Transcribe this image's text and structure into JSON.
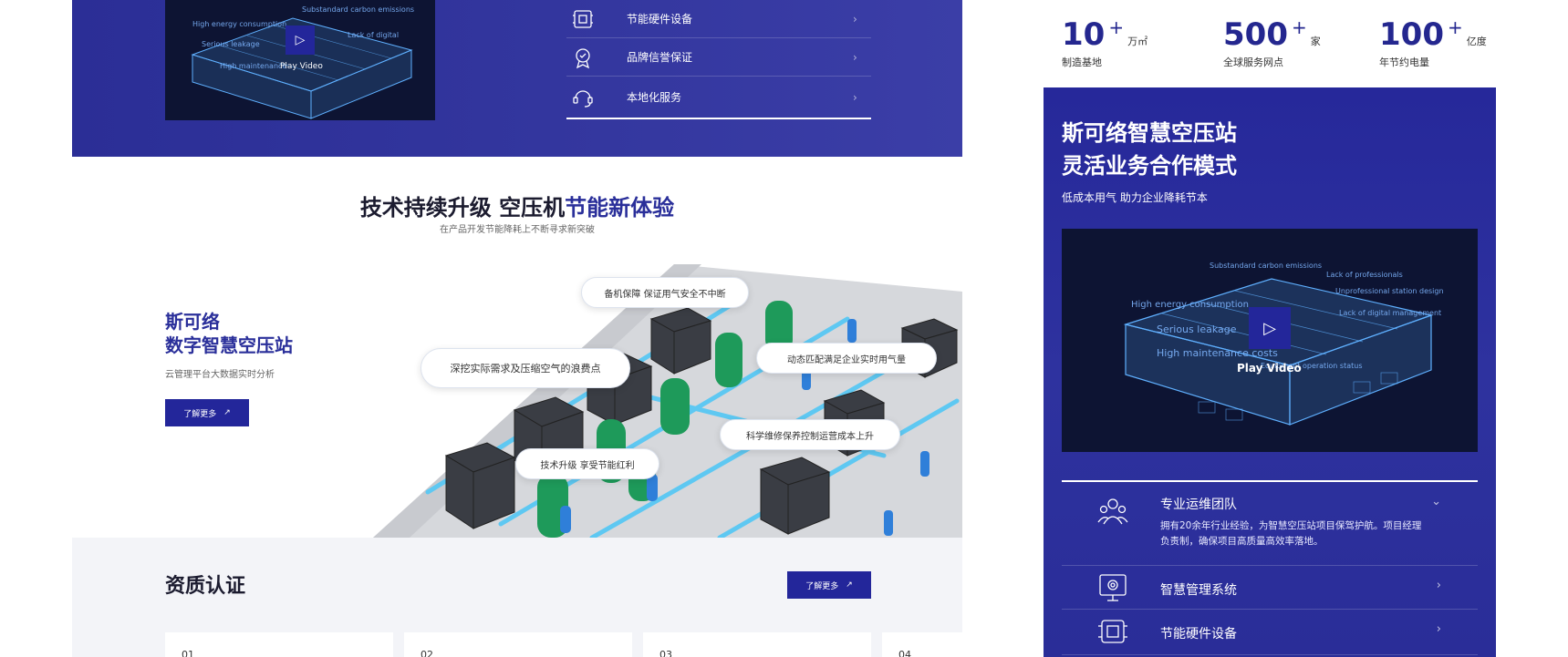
{
  "left_video": {
    "play_label": "Play Video",
    "overlay_labels": [
      "High energy consumption",
      "Substandard carbon emissions",
      "Serious leakage",
      "Lack of digital",
      "High maintenance"
    ]
  },
  "services": [
    {
      "label": "节能硬件设备",
      "icon": "hardware-icon"
    },
    {
      "label": "品牌信誉保证",
      "icon": "badge-icon"
    },
    {
      "label": "本地化服务",
      "icon": "support-icon"
    }
  ],
  "tech": {
    "title_dark": "技术持续升级 空压机",
    "title_accent": "节能新体验",
    "subtitle": "在产品开发节能降耗上不断寻求新突破"
  },
  "brand": {
    "line1": "斯可络",
    "line2": "数字智慧空压站",
    "subtitle": "云管理平台大数据实时分析",
    "button": "了解更多"
  },
  "bubbles": [
    "备机保障 保证用气安全不中断",
    "深挖实际需求及压缩空气的浪费点",
    "动态匹配满足企业实时用气量",
    "科学维修保养控制运营成本上升",
    "技术升级 享受节能红利"
  ],
  "qualification": {
    "title": "资质认证",
    "button": "了解更多",
    "cards": [
      "01",
      "02",
      "03",
      "04"
    ]
  },
  "stats": [
    {
      "number": "10",
      "plus": "+",
      "unit": "万㎡",
      "desc": "制造基地"
    },
    {
      "number": "500",
      "plus": "+",
      "unit": "家",
      "desc": "全球服务网点"
    },
    {
      "number": "100",
      "plus": "+",
      "unit": "亿度",
      "desc": "年节约电量"
    }
  ],
  "right_panel": {
    "title_line1": "斯可络智慧空压站",
    "title_line2": "灵活业务合作模式",
    "subtitle": "低成本用气 助力企业降耗节本",
    "video": {
      "play_label": "Play Video",
      "overlay_labels": [
        "Substandard carbon emissions",
        "Lack of professionals",
        "High energy consumption",
        "Unprofessional station design",
        "Serious leakage",
        "Lack of digital management",
        "High maintenance costs",
        "Equipment operation status"
      ]
    },
    "accordion": [
      {
        "label": "专业运维团队",
        "desc": "拥有20余年行业经验，为智慧空压站项目保驾护航。项目经理负责制，确保项目高质量高效率落地。",
        "icon": "team-icon",
        "expanded": true
      },
      {
        "label": "智慧管理系统",
        "icon": "gear-monitor-icon"
      },
      {
        "label": "节能硬件设备",
        "icon": "hardware-icon"
      }
    ]
  },
  "colors": {
    "brand_blue": "#2a2f9a",
    "panel_blue": "#2b2e96",
    "accent_green": "#1e9a5a",
    "pipe_blue": "#5ec8f2"
  }
}
